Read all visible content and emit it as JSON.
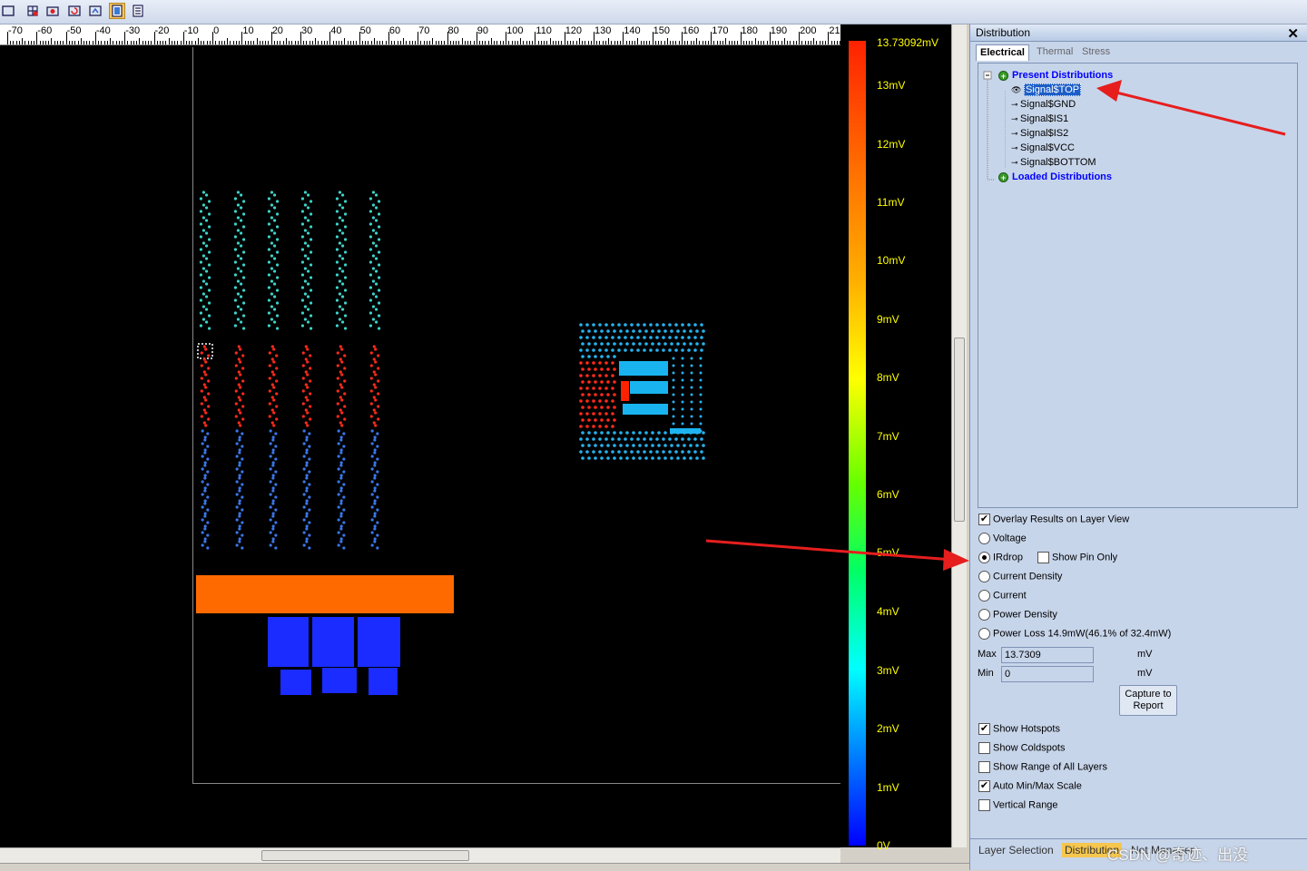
{
  "toolbar": {
    "icons": [
      "zoom-fit-icon",
      "grid-select-icon",
      "snapshot-icon",
      "refresh-icon",
      "layer-icon",
      "distribution-icon",
      "report-icon"
    ]
  },
  "ruler": {
    "labels": [
      "-70",
      "-60",
      "-50",
      "-40",
      "-30",
      "-20",
      "-10",
      "0",
      "10",
      "20",
      "30",
      "40",
      "50",
      "60",
      "70",
      "80",
      "90",
      "100",
      "110",
      "120",
      "130",
      "140",
      "150",
      "160",
      "170",
      "180",
      "190",
      "200",
      "21"
    ]
  },
  "legend": {
    "max_label": "13.73092mV",
    "labels": [
      "13mV",
      "12mV",
      "11mV",
      "10mV",
      "9mV",
      "8mV",
      "7mV",
      "6mV",
      "5mV",
      "4mV",
      "3mV",
      "2mV",
      "1mV",
      "0V"
    ],
    "colors": {
      "top": "#ff2200",
      "bottom": "#0000ff"
    }
  },
  "panel": {
    "title": "Distribution",
    "tabs": [
      "Electrical",
      "Thermal",
      "Stress"
    ],
    "tree": {
      "present_label": "Present Distributions",
      "items": [
        "Signal$TOP",
        "Signal$GND",
        "Signal$IS1",
        "Signal$IS2",
        "Signal$VCC",
        "Signal$BOTTOM"
      ],
      "selected": "Signal$TOP",
      "loaded_label": "Loaded Distributions"
    },
    "options": {
      "overlay": {
        "label": "Overlay Results on Layer View",
        "checked": true
      },
      "voltage": {
        "label": "Voltage",
        "selected": false
      },
      "irdrop": {
        "label": "IRdrop",
        "selected": true
      },
      "show_pin_only": {
        "label": "Show Pin Only",
        "checked": false
      },
      "current_density": {
        "label": "Current Density",
        "selected": false
      },
      "current": {
        "label": "Current",
        "selected": false
      },
      "power_density": {
        "label": "Power Density",
        "selected": false
      },
      "power_loss": {
        "label": "Power Loss 14.9mW(46.1% of 32.4mW)",
        "selected": false
      }
    },
    "max": {
      "label": "Max",
      "value": "13.7309",
      "unit": "mV"
    },
    "min": {
      "label": "Min",
      "value": "0",
      "unit": "mV"
    },
    "capture_button": "Capture to Report",
    "checks": {
      "hotspots": {
        "label": "Show Hotspots",
        "checked": true
      },
      "coldspots": {
        "label": "Show Coldspots",
        "checked": false
      },
      "range_all": {
        "label": "Show Range of All Layers",
        "checked": false
      },
      "auto_minmax": {
        "label": "Auto Min/Max Scale",
        "checked": true
      },
      "vertical_range": {
        "label": "Vertical Range",
        "checked": false
      }
    },
    "bottom_tabs": [
      "Layer Selection",
      "Distribution",
      "Net Manager"
    ]
  },
  "watermark": "CSDN @奇迹、出没"
}
